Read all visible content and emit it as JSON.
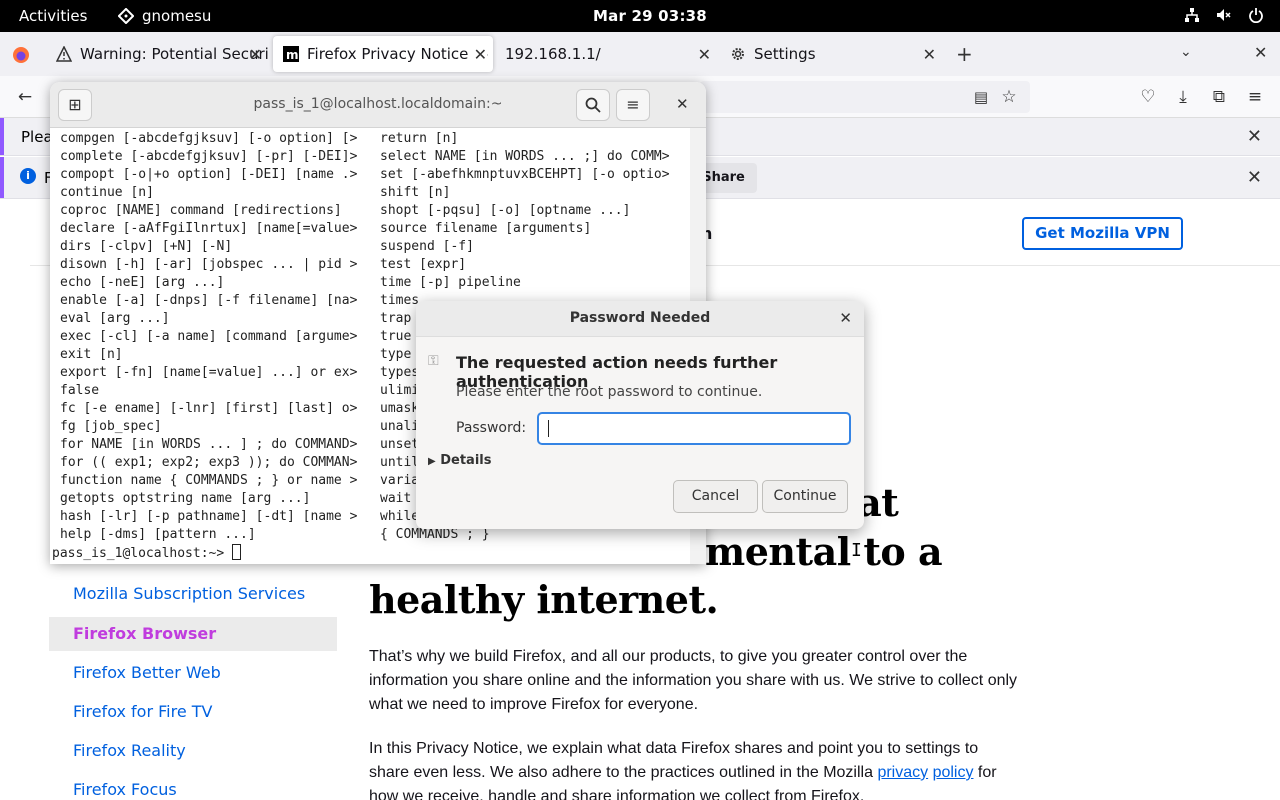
{
  "topbar": {
    "activities": "Activities",
    "app_name": "gnomesu",
    "clock": "Mar 29  03:38"
  },
  "tabs": [
    {
      "label": "Warning: Potential Security Risk Ahead"
    },
    {
      "label": "Firefox Privacy Notice — Mozilla"
    },
    {
      "label": "192.168.1.1/"
    },
    {
      "label": "Settings"
    }
  ],
  "notifications": {
    "bar1_text": "Pleas",
    "bar2_text": "F",
    "bar2_button": "Choose What I Share"
  },
  "page": {
    "vpn_button": "Get Mozilla VPN",
    "heading_partial": "on",
    "headline_line1": "hat",
    "headline_line2": "mental to a",
    "headline_line3": "healthy internet.",
    "sidebar": [
      "Mozilla Subscription Services",
      "Firefox Browser",
      "Firefox Better Web",
      "Firefox for Fire TV",
      "Firefox Reality",
      "Firefox Focus"
    ],
    "para1": "That’s why we build Firefox, and all our products, to give you greater control over the information you share online and the information you share with us. We strive to collect only what we need to improve Firefox for everyone.",
    "para2_a": "In this Privacy Notice, we explain what data Firefox shares and point you to settings to share even less. We also adhere to the practices outlined in the Mozilla ",
    "para2_link1": "privacy",
    "para2_link2": "policy",
    "para2_b": " for how we receive, handle and share information we collect from Firefox."
  },
  "terminal": {
    "title": "pass_is_1@localhost.localdomain:~",
    "left_column": "compgen [-abcdefgjksuv] [-o option] [>\ncomplete [-abcdefgjksuv] [-pr] [-DEI]>\ncompopt [-o|+o option] [-DEI] [name .>\ncontinue [n]\ncoproc [NAME] command [redirections]\ndeclare [-aAfFgiIlnrtux] [name[=value>\ndirs [-clpv] [+N] [-N]\ndisown [-h] [-ar] [jobspec ... | pid >\necho [-neE] [arg ...]\nenable [-a] [-dnps] [-f filename] [na>\neval [arg ...]\nexec [-cl] [-a name] [command [argume>\nexit [n]\nexport [-fn] [name[=value] ...] or ex>\nfalse\nfc [-e ename] [-lnr] [first] [last] o>\nfg [job_spec]\nfor NAME [in WORDS ... ] ; do COMMAND>\nfor (( exp1; exp2; exp3 )); do COMMAN>\nfunction name { COMMANDS ; } or name >\ngetopts optstring name [arg ...]\nhash [-lr] [-p pathname] [-dt] [name >\nhelp [-dms] [pattern ...]",
    "right_column": "return [n]\nselect NAME [in WORDS ... ;] do COMM>\nset [-abefhkmnptuvxBCEHPT] [-o optio>\nshift [n]\nshopt [-pqsu] [-o] [optname ...]\nsource filename [arguments]\nsuspend [-f]\ntest [expr]\ntime [-p] pipeline\ntimes\ntrap\ntrue\ntype\ntypes\nulimi\numask\nunali\nunset\nuntil\nvaria\nwait\nwhile\n{ COMMANDS ; }",
    "prompt": "pass_is_1@localhost:~> "
  },
  "dialog": {
    "title": "Password Needed",
    "heading": "The requested action needs further authentication",
    "message": "Please enter the root password to continue.",
    "password_label": "Password:",
    "password_value": "",
    "details": "Details",
    "cancel": "Cancel",
    "continue": "Continue"
  }
}
